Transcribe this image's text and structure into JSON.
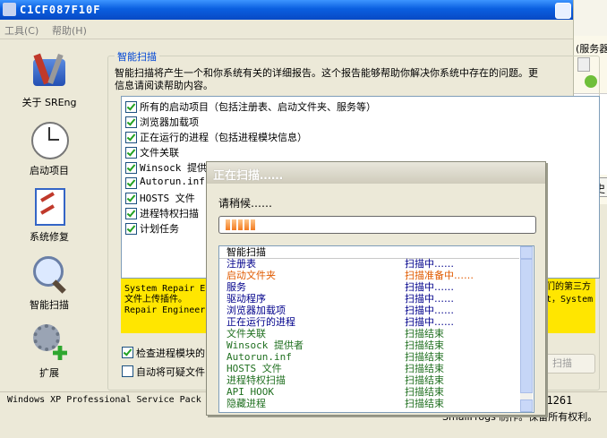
{
  "window": {
    "title": "C1CF087F10F"
  },
  "menu": {
    "tools": "工具(C)",
    "help": "帮助(H)"
  },
  "nav": [
    {
      "label": "关于 SREng"
    },
    {
      "label": "启动项目"
    },
    {
      "label": "系统修复"
    },
    {
      "label": "智能扫描"
    },
    {
      "label": "扩展"
    }
  ],
  "group": {
    "title": "智能扫描",
    "desc1": "智能扫描将产生一个和你系统有关的详细报告。这个报告能够帮助你解决你系统中存在的问题。更",
    "desc2": "信息请阅读帮助内容。"
  },
  "scan_items": [
    {
      "label": "所有的启动项目（包括注册表、启动文件夹、服务等）",
      "checked": true
    },
    {
      "label": "浏览器加载项",
      "checked": true
    },
    {
      "label": "正在运行的进程（包括进程模块信息）",
      "checked": true
    },
    {
      "label": "文件关联",
      "checked": true
    },
    {
      "label": "Winsock 提供",
      "checked": true
    },
    {
      "label": "Autorun.inf",
      "checked": true
    },
    {
      "label": "HOSTS 文件",
      "checked": true
    },
    {
      "label": "进程特权扫描",
      "checked": true
    },
    {
      "label": "计划任务",
      "checked": true
    }
  ],
  "notice": {
    "line1_a": "System Repair E",
    "line1_b": "们的第三方",
    "line2_a": "文件上传插件。",
    "line2_b": "t，System",
    "line3": "Repair Engineer"
  },
  "options": {
    "check_modules": "检查进程模块的",
    "auto_upload": "自动将可疑文件"
  },
  "scan_button": "扫描",
  "statusbar": {
    "os": "Windows XP Professional Service Pack",
    "version": "1.1261"
  },
  "copyright": "SmallFrogs 制作。保留所有权利。",
  "right_window": {
    "text1": "(服务器",
    "tab": "历史"
  },
  "dialog": {
    "title": "正在扫描……",
    "wait": "请稍候……",
    "progress_blocks": 5,
    "header": {
      "name": "智能扫描",
      "status": ""
    },
    "rows": [
      {
        "name": "注册表",
        "status": "扫描中……",
        "color": "#00008b"
      },
      {
        "name": "启动文件夹",
        "status": "扫描准备中……",
        "color": "#e05a00"
      },
      {
        "name": "服务",
        "status": "扫描中……",
        "color": "#00008b"
      },
      {
        "name": "驱动程序",
        "status": "扫描中……",
        "color": "#00008b"
      },
      {
        "name": "浏览器加载项",
        "status": "扫描中……",
        "color": "#00008b"
      },
      {
        "name": "正在运行的进程",
        "status": "扫描中……",
        "color": "#00008b"
      },
      {
        "name": "文件关联",
        "status": "扫描结束",
        "color": "#207020"
      },
      {
        "name": "Winsock 提供者",
        "status": "扫描结束",
        "color": "#207020"
      },
      {
        "name": "Autorun.inf",
        "status": "扫描结束",
        "color": "#207020"
      },
      {
        "name": "HOSTS 文件",
        "status": "扫描结束",
        "color": "#207020"
      },
      {
        "name": "进程特权扫描",
        "status": "扫描结束",
        "color": "#207020"
      },
      {
        "name": "API HOOK",
        "status": "扫描结束",
        "color": "#207020"
      },
      {
        "name": "隐藏进程",
        "status": "扫描结束",
        "color": "#207020"
      }
    ]
  }
}
